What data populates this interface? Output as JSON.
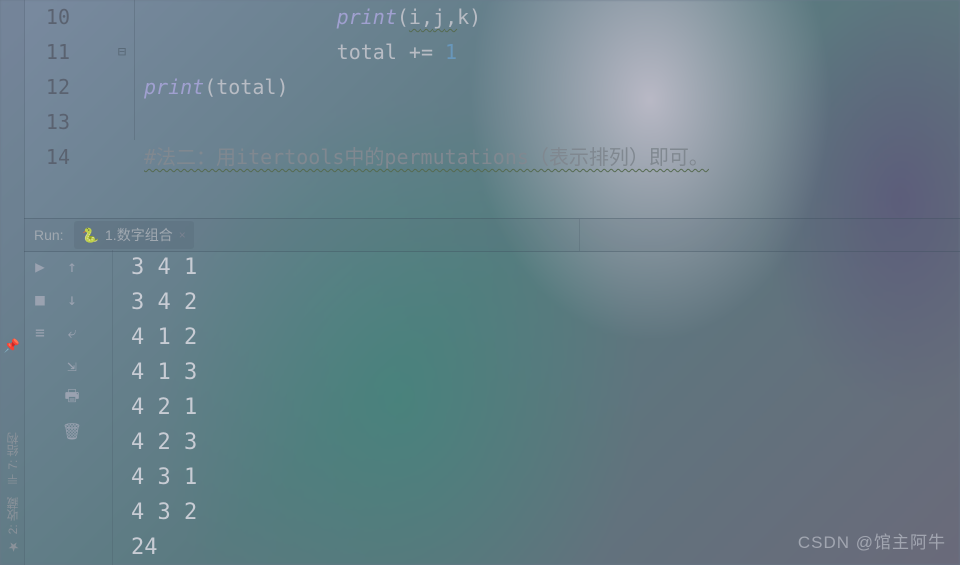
{
  "editor": {
    "lines": [
      {
        "num": "10",
        "indent": "                ",
        "tokens": [
          {
            "t": "print",
            "c": "fn"
          },
          {
            "t": "(",
            "c": "pn"
          },
          {
            "t": "i",
            "c": "id wavy"
          },
          {
            "t": ",",
            "c": "pn wavy"
          },
          {
            "t": "j",
            "c": "id wavy"
          },
          {
            "t": ",",
            "c": "pn wavy"
          },
          {
            "t": "k",
            "c": "id"
          },
          {
            "t": ")",
            "c": "pn"
          }
        ]
      },
      {
        "num": "11",
        "indent": "                ",
        "fold": "⊟",
        "tokens": [
          {
            "t": "total ",
            "c": "id"
          },
          {
            "t": "+= ",
            "c": "op"
          },
          {
            "t": "1",
            "c": "num"
          }
        ]
      },
      {
        "num": "12",
        "indent": "",
        "tokens": [
          {
            "t": "print",
            "c": "fn"
          },
          {
            "t": "(",
            "c": "pn"
          },
          {
            "t": "total",
            "c": "id"
          },
          {
            "t": ")",
            "c": "pn"
          }
        ]
      },
      {
        "num": "13",
        "indent": "",
        "tokens": []
      },
      {
        "num": "14",
        "indent": "",
        "tokens": [
          {
            "t": "#法二：用itertools中的permutations（表示排列）即可。",
            "c": "cm wavy"
          }
        ]
      }
    ]
  },
  "run": {
    "label": "Run:",
    "tab": {
      "name": "1.数字组合",
      "close": "×",
      "pyglyph": "🐍"
    },
    "tools": {
      "rerun": "▶",
      "up": "↑",
      "stop": "■",
      "down": "↓",
      "layout": "≡",
      "wrap": "⤶",
      "scroll": "⇲",
      "print": "🖶",
      "trash": "🗑"
    },
    "output": [
      "3 4 1",
      "3 4 2",
      "4 1 2",
      "4 1 3",
      "4 2 1",
      "4 2 3",
      "4 3 1",
      "4 3 2",
      "24"
    ]
  },
  "left": {
    "structure": {
      "icon": "⊪",
      "label": "7: 结构"
    },
    "favorite": {
      "icon": "★",
      "label": "2: 收藏"
    },
    "pin": "📌"
  },
  "watermark": "CSDN @馆主阿牛"
}
